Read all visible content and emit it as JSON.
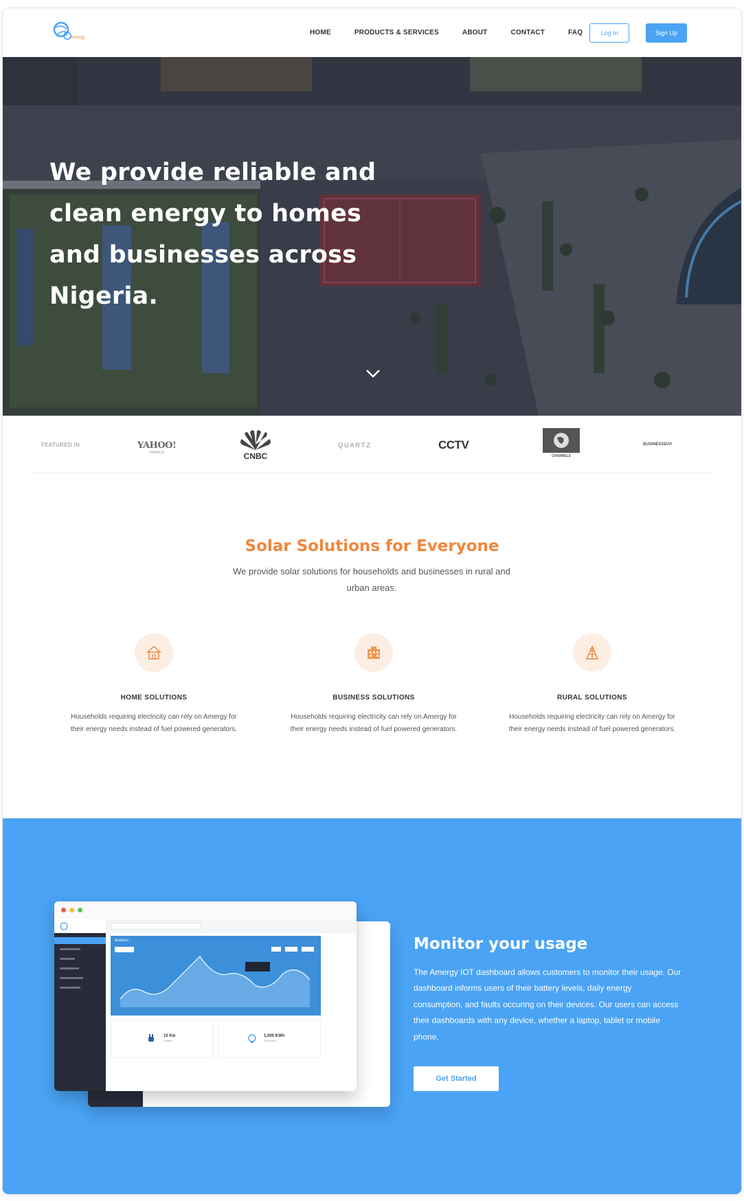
{
  "nav": {
    "logo_icon": "globe-logo-icon",
    "logo_text": "Amergy",
    "links": [
      "HOME",
      "PRODUCTS & SERVICES",
      "ABOUT",
      "CONTACT",
      "FAQ"
    ],
    "login_label": "Log In",
    "signup_label": "Sign Up"
  },
  "hero": {
    "title": "We provide reliable and clean energy to homes and businesses across Nigeria.",
    "scroll_icon": "chevron-down-icon"
  },
  "featured": {
    "label": "FEATURED IN",
    "logos": [
      "YAHOO!",
      "CNBC",
      "QUARTZ",
      "CCTV",
      "CHANNELS",
      "BUSINESSDAY"
    ],
    "yahoo_sub": "FINANCE"
  },
  "solutions": {
    "title": "Solar Solutions for Everyone",
    "subtitle": "We provide solar solutions for households and businesses in rural and urban areas.",
    "cards": [
      {
        "icon": "house-icon",
        "title": "HOME SOLUTIONS",
        "text": "Households requiring electricity can rely on Amergy for their energy needs instead of fuel powered generators."
      },
      {
        "icon": "building-icon",
        "title": "BUSINESS SOLUTIONS",
        "text": "Households requiring electricity can rely on Amergy for their energy needs instead of fuel powered generators."
      },
      {
        "icon": "rural-tower-icon",
        "title": "RURAL SOLUTIONS",
        "text": "Households requiring electricity can rely on Amergy for their energy needs instead of fuel powered generators."
      }
    ]
  },
  "monitor": {
    "title": "Monitor your usage",
    "text": "The Amergy IOT dashboard allows customers to monitor their usage. Our dashboard informs users of their battery levels, daily energy consumption, and faults occuring on their devices. Our users can access their dashboards with any device, whether a laptop, tablet or mobile phone.",
    "button_label": "Get Started",
    "dashboard": {
      "chart_title": "Analytics",
      "stat1": "10 Kw",
      "stat1_sub": "Installed",
      "stat2": "1,000 KWh",
      "stat2_sub": "Total power"
    }
  },
  "colors": {
    "accent_blue": "#4aa3f4",
    "accent_orange": "#f0873c",
    "dashboard_sidebar": "#282c3a"
  }
}
